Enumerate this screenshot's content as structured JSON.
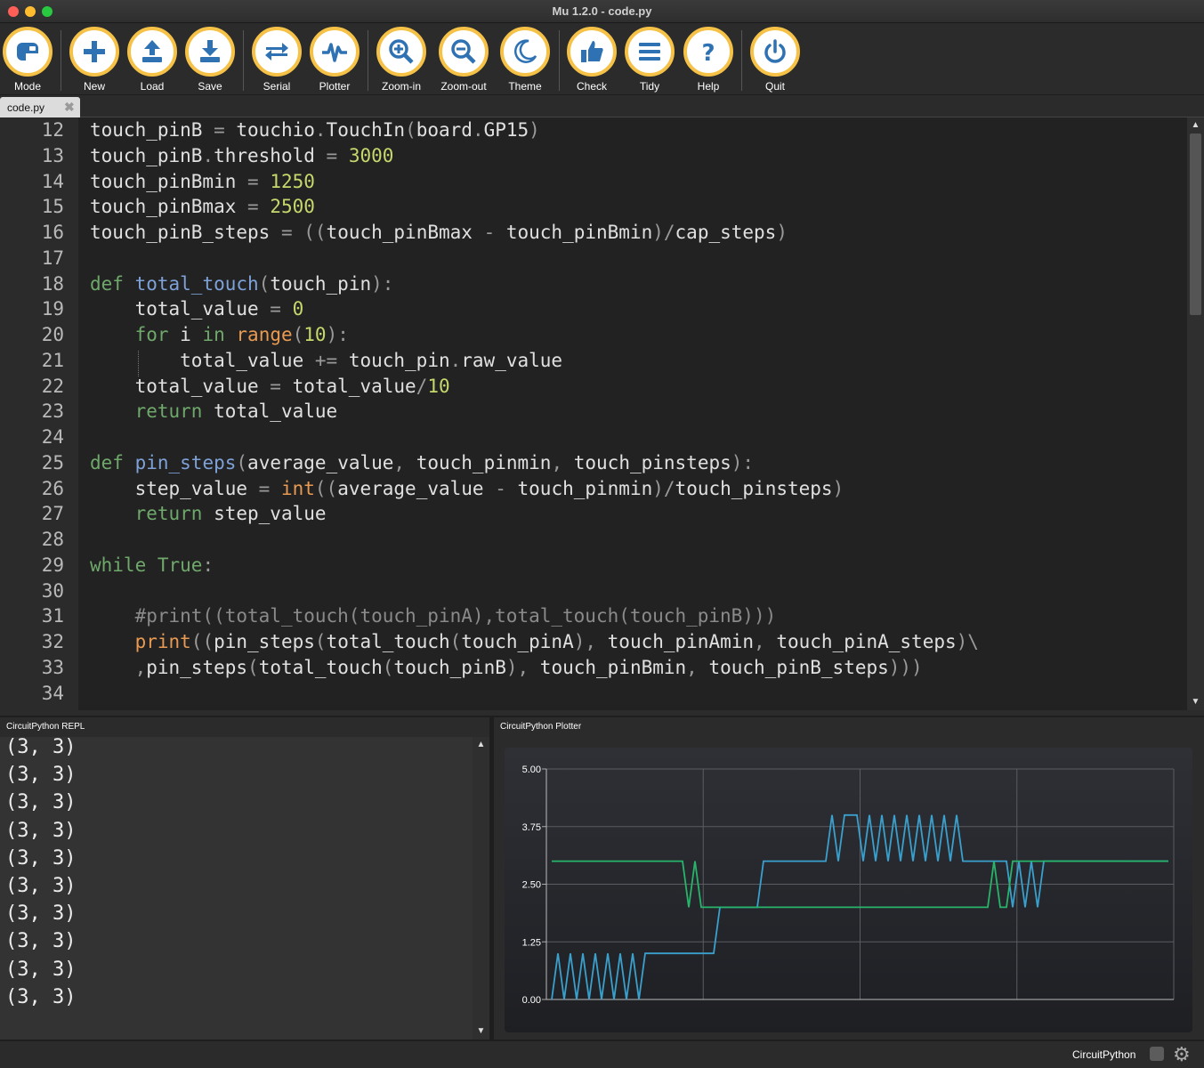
{
  "window": {
    "title": "Mu 1.2.0 - code.py"
  },
  "toolbar": {
    "buttons": [
      {
        "label": "Mode",
        "icon": "mode-icon"
      },
      {
        "label": "New",
        "icon": "plus-icon"
      },
      {
        "label": "Load",
        "icon": "upload-icon"
      },
      {
        "label": "Save",
        "icon": "download-icon"
      },
      {
        "label": "Serial",
        "icon": "serial-arrows-icon"
      },
      {
        "label": "Plotter",
        "icon": "pulse-icon"
      },
      {
        "label": "Zoom-in",
        "icon": "zoom-in-icon"
      },
      {
        "label": "Zoom-out",
        "icon": "zoom-out-icon"
      },
      {
        "label": "Theme",
        "icon": "moon-icon"
      },
      {
        "label": "Check",
        "icon": "thumbs-up-icon"
      },
      {
        "label": "Tidy",
        "icon": "lines-icon"
      },
      {
        "label": "Help",
        "icon": "question-icon"
      },
      {
        "label": "Quit",
        "icon": "power-icon"
      }
    ],
    "accent": "#f5c146",
    "icon_color": "#2f72b4"
  },
  "tabs": [
    {
      "label": "code.py",
      "close": "✖"
    }
  ],
  "editor": {
    "lines": [
      {
        "n": "12",
        "tokens": [
          [
            "touch_pinB ",
            "t"
          ],
          [
            "=",
            "o"
          ],
          [
            " touchio",
            "t"
          ],
          [
            ".",
            "o"
          ],
          [
            "TouchIn",
            "t"
          ],
          [
            "(",
            "o"
          ],
          [
            "board",
            "t"
          ],
          [
            ".",
            "o"
          ],
          [
            "GP15",
            "t"
          ],
          [
            ")",
            "o"
          ]
        ]
      },
      {
        "n": "13",
        "tokens": [
          [
            "touch_pinB",
            "t"
          ],
          [
            ".",
            "o"
          ],
          [
            "threshold ",
            "t"
          ],
          [
            "=",
            "o"
          ],
          [
            " ",
            "t"
          ],
          [
            "3000",
            "num"
          ]
        ]
      },
      {
        "n": "14",
        "tokens": [
          [
            "touch_pinBmin ",
            "t"
          ],
          [
            "=",
            "o"
          ],
          [
            " ",
            "t"
          ],
          [
            "1250",
            "num"
          ]
        ]
      },
      {
        "n": "15",
        "tokens": [
          [
            "touch_pinBmax ",
            "t"
          ],
          [
            "=",
            "o"
          ],
          [
            " ",
            "t"
          ],
          [
            "2500",
            "num"
          ]
        ]
      },
      {
        "n": "16",
        "tokens": [
          [
            "touch_pinB_steps ",
            "t"
          ],
          [
            "=",
            "o"
          ],
          [
            " ",
            "t"
          ],
          [
            "((",
            "o"
          ],
          [
            "touch_pinBmax ",
            "t"
          ],
          [
            "-",
            "o"
          ],
          [
            " touch_pinBmin",
            "t"
          ],
          [
            ")/",
            "o"
          ],
          [
            "cap_steps",
            "t"
          ],
          [
            ")",
            "o"
          ]
        ]
      },
      {
        "n": "17",
        "tokens": []
      },
      {
        "n": "18",
        "tokens": [
          [
            "def",
            "kw"
          ],
          [
            " ",
            "t"
          ],
          [
            "total_touch",
            "fn"
          ],
          [
            "(",
            "o"
          ],
          [
            "touch_pin",
            "t"
          ],
          [
            "):",
            "o"
          ]
        ]
      },
      {
        "n": "19",
        "tokens": [
          [
            "    total_value ",
            "t"
          ],
          [
            "=",
            "o"
          ],
          [
            " ",
            "t"
          ],
          [
            "0",
            "num"
          ]
        ]
      },
      {
        "n": "20",
        "tokens": [
          [
            "    ",
            "t"
          ],
          [
            "for",
            "kw"
          ],
          [
            " i ",
            "t"
          ],
          [
            "in",
            "kw"
          ],
          [
            " ",
            "t"
          ],
          [
            "range",
            "bi"
          ],
          [
            "(",
            "o"
          ],
          [
            "10",
            "num"
          ],
          [
            "):",
            "o"
          ]
        ]
      },
      {
        "n": "21",
        "tokens": [
          [
            "        total_value ",
            "t"
          ],
          [
            "+=",
            "o"
          ],
          [
            " touch_pin",
            "t"
          ],
          [
            ".",
            "o"
          ],
          [
            "raw_value",
            "t"
          ]
        ]
      },
      {
        "n": "22",
        "tokens": [
          [
            "    total_value ",
            "t"
          ],
          [
            "=",
            "o"
          ],
          [
            " total_value",
            "t"
          ],
          [
            "/",
            "o"
          ],
          [
            "10",
            "num"
          ]
        ]
      },
      {
        "n": "23",
        "tokens": [
          [
            "    ",
            "t"
          ],
          [
            "return",
            "kw"
          ],
          [
            " total_value",
            "t"
          ]
        ]
      },
      {
        "n": "24",
        "tokens": []
      },
      {
        "n": "25",
        "tokens": [
          [
            "def",
            "kw"
          ],
          [
            " ",
            "t"
          ],
          [
            "pin_steps",
            "fn"
          ],
          [
            "(",
            "o"
          ],
          [
            "average_value",
            "t"
          ],
          [
            ",",
            "o"
          ],
          [
            " touch_pinmin",
            "t"
          ],
          [
            ",",
            "o"
          ],
          [
            " touch_pinsteps",
            "t"
          ],
          [
            "):",
            "o"
          ]
        ]
      },
      {
        "n": "26",
        "tokens": [
          [
            "    step_value ",
            "t"
          ],
          [
            "=",
            "o"
          ],
          [
            " ",
            "t"
          ],
          [
            "int",
            "bi"
          ],
          [
            "((",
            "o"
          ],
          [
            "average_value ",
            "t"
          ],
          [
            "-",
            "o"
          ],
          [
            " touch_pinmin",
            "t"
          ],
          [
            ")/",
            "o"
          ],
          [
            "touch_pinsteps",
            "t"
          ],
          [
            ")",
            "o"
          ]
        ]
      },
      {
        "n": "27",
        "tokens": [
          [
            "    ",
            "t"
          ],
          [
            "return",
            "kw"
          ],
          [
            " step_value",
            "t"
          ]
        ]
      },
      {
        "n": "28",
        "tokens": []
      },
      {
        "n": "29",
        "tokens": [
          [
            "while",
            "kw"
          ],
          [
            " ",
            "t"
          ],
          [
            "True",
            "kw"
          ],
          [
            ":",
            "o"
          ]
        ]
      },
      {
        "n": "30",
        "tokens": []
      },
      {
        "n": "31",
        "tokens": [
          [
            "    ",
            "t"
          ],
          [
            "#print((total_touch(touch_pinA),total_touch(touch_pinB)))",
            "cm"
          ]
        ]
      },
      {
        "n": "32",
        "tokens": [
          [
            "    ",
            "t"
          ],
          [
            "print",
            "bi"
          ],
          [
            "((",
            "o"
          ],
          [
            "pin_steps",
            "t"
          ],
          [
            "(",
            "o"
          ],
          [
            "total_touch",
            "t"
          ],
          [
            "(",
            "o"
          ],
          [
            "touch_pinA",
            "t"
          ],
          [
            "),",
            "o"
          ],
          [
            " touch_pinAmin",
            "t"
          ],
          [
            ",",
            "o"
          ],
          [
            " touch_pinA_steps",
            "t"
          ],
          [
            ")\\",
            "o"
          ]
        ]
      },
      {
        "n": "33",
        "tokens": [
          [
            "    ",
            "t"
          ],
          [
            ",",
            "o"
          ],
          [
            "pin_steps",
            "t"
          ],
          [
            "(",
            "o"
          ],
          [
            "total_touch",
            "t"
          ],
          [
            "(",
            "o"
          ],
          [
            "touch_pinB",
            "t"
          ],
          [
            "),",
            "o"
          ],
          [
            " touch_pinBmin",
            "t"
          ],
          [
            ",",
            "o"
          ],
          [
            " touch_pinB_steps",
            "t"
          ],
          [
            ")))",
            "o"
          ]
        ]
      },
      {
        "n": "34",
        "tokens": []
      }
    ],
    "colors": {
      "t": "#e0e0e0",
      "o": "#9a9a9a",
      "num": "#c6d86c",
      "kw": "#6fa86b",
      "fn": "#7ea2d8",
      "bi": "#e89a52",
      "cm": "#8a8a8a"
    }
  },
  "repl": {
    "title": "CircuitPython REPL",
    "lines": [
      "(3, 3)",
      "(3, 3)",
      "(3, 3)",
      "(3, 3)",
      "(3, 3)",
      "(3, 3)",
      "(3, 3)",
      "(3, 3)",
      "(3, 3)",
      "(3, 3)"
    ]
  },
  "plotter": {
    "title": "CircuitPython Plotter",
    "chart_data": {
      "type": "line",
      "ylim": [
        0,
        5
      ],
      "yticks": [
        "5.00",
        "3.75",
        "2.50",
        "1.25",
        "0.00"
      ],
      "xlim": [
        0,
        100
      ],
      "grid": true,
      "series": [
        {
          "color": "#3aa0cd",
          "values": [
            0,
            1,
            0,
            1,
            0,
            1,
            0,
            1,
            0,
            1,
            0,
            1,
            0,
            1,
            0,
            1,
            1,
            1,
            1,
            1,
            1,
            1,
            1,
            1,
            1,
            1,
            1,
            2,
            2,
            2,
            2,
            2,
            2,
            2,
            3,
            3,
            3,
            3,
            3,
            3,
            3,
            3,
            3,
            3,
            3,
            4,
            3,
            4,
            4,
            4,
            3,
            4,
            3,
            4,
            3,
            4,
            3,
            4,
            3,
            4,
            3,
            4,
            3,
            4,
            3,
            4,
            3,
            3,
            3,
            3,
            3,
            3,
            3,
            3,
            2,
            3,
            2,
            3,
            2,
            3,
            3,
            3,
            3,
            3,
            3,
            3,
            3,
            3,
            3,
            3,
            3,
            3,
            3,
            3,
            3,
            3,
            3,
            3,
            3,
            3
          ]
        },
        {
          "color": "#27b56b",
          "values": [
            3,
            3,
            3,
            3,
            3,
            3,
            3,
            3,
            3,
            3,
            3,
            3,
            3,
            3,
            3,
            3,
            3,
            3,
            3,
            3,
            3,
            3,
            2,
            3,
            2,
            2,
            2,
            2,
            2,
            2,
            2,
            2,
            2,
            2,
            2,
            2,
            2,
            2,
            2,
            2,
            2,
            2,
            2,
            2,
            2,
            2,
            2,
            2,
            2,
            2,
            2,
            2,
            2,
            2,
            2,
            2,
            2,
            2,
            2,
            2,
            2,
            2,
            2,
            2,
            2,
            2,
            2,
            2,
            2,
            2,
            2,
            3,
            2,
            2,
            3,
            3,
            3,
            3,
            3,
            3,
            3,
            3,
            3,
            3,
            3,
            3,
            3,
            3,
            3,
            3,
            3,
            3,
            3,
            3,
            3,
            3,
            3,
            3,
            3,
            3
          ]
        }
      ]
    }
  },
  "status": {
    "mode": "CircuitPython"
  }
}
